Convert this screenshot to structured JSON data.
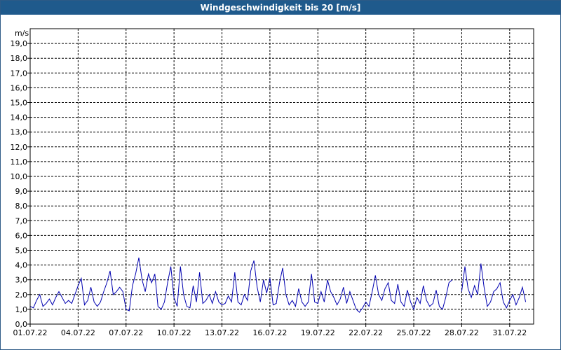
{
  "window": {
    "title": "Windgeschwindigkeit bis 20 [m/s]"
  },
  "chart_data": {
    "type": "line",
    "title": "Windgeschwindigkeit bis 20 [m/s]",
    "ylabel": "m/s",
    "xlabel": "",
    "ylim": [
      0,
      20
    ],
    "xlim": [
      0,
      31.5
    ],
    "grid": true,
    "line_color": "#0000b0",
    "y_ticks": [
      "0,0",
      "1,0",
      "2,0",
      "3,0",
      "4,0",
      "5,0",
      "6,0",
      "7,0",
      "8,0",
      "9,0",
      "10,0",
      "11,0",
      "12,0",
      "13,0",
      "14,0",
      "15,0",
      "16,0",
      "17,0",
      "18,0",
      "19,0"
    ],
    "x_ticks": [
      {
        "day": 0,
        "label": "01.07.22"
      },
      {
        "day": 3,
        "label": "04.07.22"
      },
      {
        "day": 6,
        "label": "07.07.22"
      },
      {
        "day": 9,
        "label": "10.07.22"
      },
      {
        "day": 12,
        "label": "13.07.22"
      },
      {
        "day": 15,
        "label": "16.07.22"
      },
      {
        "day": 18,
        "label": "19.07.22"
      },
      {
        "day": 21,
        "label": "22.07.22"
      },
      {
        "day": 24,
        "label": "25.07.22"
      },
      {
        "day": 27,
        "label": "28.07.22"
      },
      {
        "day": 30,
        "label": "31.07.22"
      }
    ],
    "series": [
      {
        "segments": [
          [
            [
              0,
              1.2
            ],
            [
              0.2,
              1.1
            ],
            [
              0.4,
              1.6
            ],
            [
              0.6,
              2.0
            ],
            [
              0.8,
              1.2
            ],
            [
              1.0,
              1.4
            ],
            [
              1.2,
              1.7
            ],
            [
              1.4,
              1.3
            ],
            [
              1.6,
              1.8
            ],
            [
              1.8,
              2.2
            ],
            [
              2.0,
              1.8
            ],
            [
              2.2,
              1.4
            ],
            [
              2.4,
              1.6
            ],
            [
              2.6,
              1.4
            ],
            [
              2.8,
              2.0
            ],
            [
              3.0,
              2.6
            ],
            [
              3.2,
              3.1
            ],
            [
              3.4,
              1.3
            ],
            [
              3.6,
              1.6
            ],
            [
              3.8,
              2.5
            ],
            [
              4.0,
              1.5
            ],
            [
              4.2,
              1.2
            ],
            [
              4.4,
              1.5
            ],
            [
              4.6,
              2.2
            ],
            [
              4.8,
              2.8
            ],
            [
              5.0,
              3.6
            ],
            [
              5.2,
              2.0
            ],
            [
              5.4,
              2.2
            ],
            [
              5.6,
              2.5
            ],
            [
              5.8,
              2.2
            ],
            [
              6.0,
              1.0
            ],
            [
              6.2,
              0.9
            ],
            [
              6.4,
              2.6
            ],
            [
              6.6,
              3.4
            ],
            [
              6.8,
              4.5
            ],
            [
              7.0,
              3.0
            ],
            [
              7.2,
              2.2
            ],
            [
              7.4,
              3.4
            ],
            [
              7.6,
              2.8
            ],
            [
              7.8,
              3.4
            ],
            [
              8.0,
              1.2
            ],
            [
              8.2,
              1.0
            ],
            [
              8.4,
              1.5
            ],
            [
              8.6,
              2.8
            ],
            [
              8.8,
              3.9
            ],
            [
              9.0,
              1.8
            ],
            [
              9.2,
              1.2
            ],
            [
              9.4,
              3.9
            ],
            [
              9.6,
              2.0
            ],
            [
              9.8,
              1.2
            ],
            [
              10.0,
              1.1
            ],
            [
              10.2,
              2.6
            ],
            [
              10.4,
              1.5
            ],
            [
              10.6,
              3.5
            ],
            [
              10.8,
              1.4
            ],
            [
              11.0,
              1.6
            ],
            [
              11.2,
              2.0
            ],
            [
              11.4,
              1.4
            ],
            [
              11.6,
              2.2
            ],
            [
              11.8,
              1.5
            ],
            [
              12.0,
              1.3
            ],
            [
              12.2,
              1.4
            ],
            [
              12.4,
              1.9
            ],
            [
              12.6,
              1.5
            ],
            [
              12.8,
              3.5
            ],
            [
              13.0,
              1.5
            ],
            [
              13.2,
              1.3
            ],
            [
              13.4,
              2.0
            ],
            [
              13.6,
              1.6
            ],
            [
              13.8,
              3.6
            ],
            [
              14.0,
              4.3
            ],
            [
              14.2,
              2.5
            ],
            [
              14.4,
              1.5
            ],
            [
              14.6,
              3.0
            ],
            [
              14.8,
              2.1
            ],
            [
              15.0,
              3.1
            ],
            [
              15.2,
              1.3
            ],
            [
              15.4,
              1.4
            ],
            [
              15.6,
              2.8
            ],
            [
              15.8,
              3.8
            ],
            [
              16.0,
              2.0
            ],
            [
              16.2,
              1.3
            ],
            [
              16.4,
              1.6
            ],
            [
              16.6,
              1.2
            ],
            [
              16.8,
              2.4
            ],
            [
              17.0,
              1.5
            ],
            [
              17.2,
              1.2
            ],
            [
              17.4,
              1.5
            ],
            [
              17.6,
              3.4
            ],
            [
              17.8,
              1.5
            ],
            [
              18.0,
              1.4
            ],
            [
              18.2,
              2.2
            ],
            [
              18.4,
              1.5
            ],
            [
              18.6,
              3.0
            ],
            [
              18.8,
              2.2
            ],
            [
              19.0,
              1.8
            ],
            [
              19.2,
              1.3
            ],
            [
              19.4,
              1.7
            ],
            [
              19.6,
              2.5
            ],
            [
              19.8,
              1.4
            ],
            [
              20.0,
              2.2
            ],
            [
              20.2,
              1.6
            ],
            [
              20.4,
              1.0
            ],
            [
              20.6,
              0.8
            ],
            [
              20.8,
              1.1
            ],
            [
              21.0,
              1.5
            ],
            [
              21.2,
              1.2
            ],
            [
              21.4,
              2.2
            ],
            [
              21.6,
              3.3
            ],
            [
              21.8,
              2.0
            ],
            [
              22.0,
              1.6
            ],
            [
              22.2,
              2.4
            ],
            [
              22.4,
              2.8
            ],
            [
              22.6,
              1.6
            ],
            [
              22.8,
              1.4
            ],
            [
              23.0,
              2.7
            ],
            [
              23.2,
              1.5
            ],
            [
              23.4,
              1.2
            ],
            [
              23.6,
              2.3
            ],
            [
              23.8,
              1.5
            ],
            [
              24.0,
              1.0
            ],
            [
              24.2,
              1.8
            ],
            [
              24.4,
              1.4
            ],
            [
              24.6,
              2.6
            ],
            [
              24.8,
              1.6
            ],
            [
              25.0,
              1.2
            ],
            [
              25.2,
              1.4
            ],
            [
              25.4,
              2.3
            ],
            [
              25.6,
              1.2
            ],
            [
              25.8,
              1.0
            ],
            [
              26.0,
              1.8
            ],
            [
              26.2,
              2.8
            ],
            [
              26.4,
              3.0
            ]
          ],
          [
            [
              27.0,
              2.2
            ],
            [
              27.2,
              3.9
            ],
            [
              27.4,
              2.4
            ],
            [
              27.6,
              1.8
            ],
            [
              27.8,
              2.6
            ],
            [
              28.0,
              2.0
            ],
            [
              28.2,
              4.1
            ],
            [
              28.4,
              2.5
            ],
            [
              28.6,
              1.2
            ],
            [
              28.8,
              1.5
            ],
            [
              29.0,
              2.2
            ],
            [
              29.2,
              2.4
            ],
            [
              29.4,
              2.8
            ],
            [
              29.6,
              1.5
            ],
            [
              29.8,
              1.1
            ],
            [
              30.0,
              1.6
            ],
            [
              30.2,
              2.0
            ],
            [
              30.4,
              1.3
            ],
            [
              30.6,
              1.8
            ],
            [
              30.8,
              2.5
            ],
            [
              31.0,
              1.5
            ]
          ]
        ]
      }
    ]
  }
}
